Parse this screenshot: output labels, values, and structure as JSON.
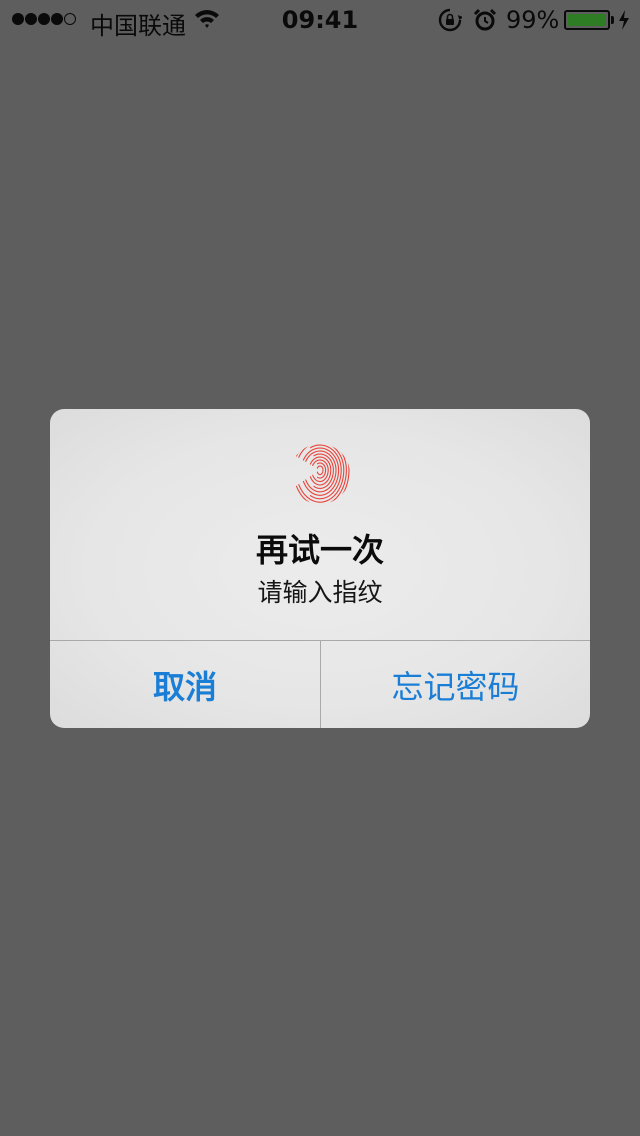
{
  "status_bar": {
    "carrier": "中国联通",
    "time": "09:41",
    "battery_percent": "99%",
    "battery_level": 0.99,
    "signal_bars_filled": 4,
    "signal_bars_total": 5,
    "battery_color": "#2e7d24"
  },
  "alert": {
    "icon": "fingerprint-icon",
    "icon_color": "#e8433a",
    "title": "再试一次",
    "message": "请输入指纹",
    "buttons": {
      "cancel": "取消",
      "forgot_password": "忘记密码"
    },
    "button_color": "#1a7ed6"
  },
  "background_color": "#5e5e5e"
}
